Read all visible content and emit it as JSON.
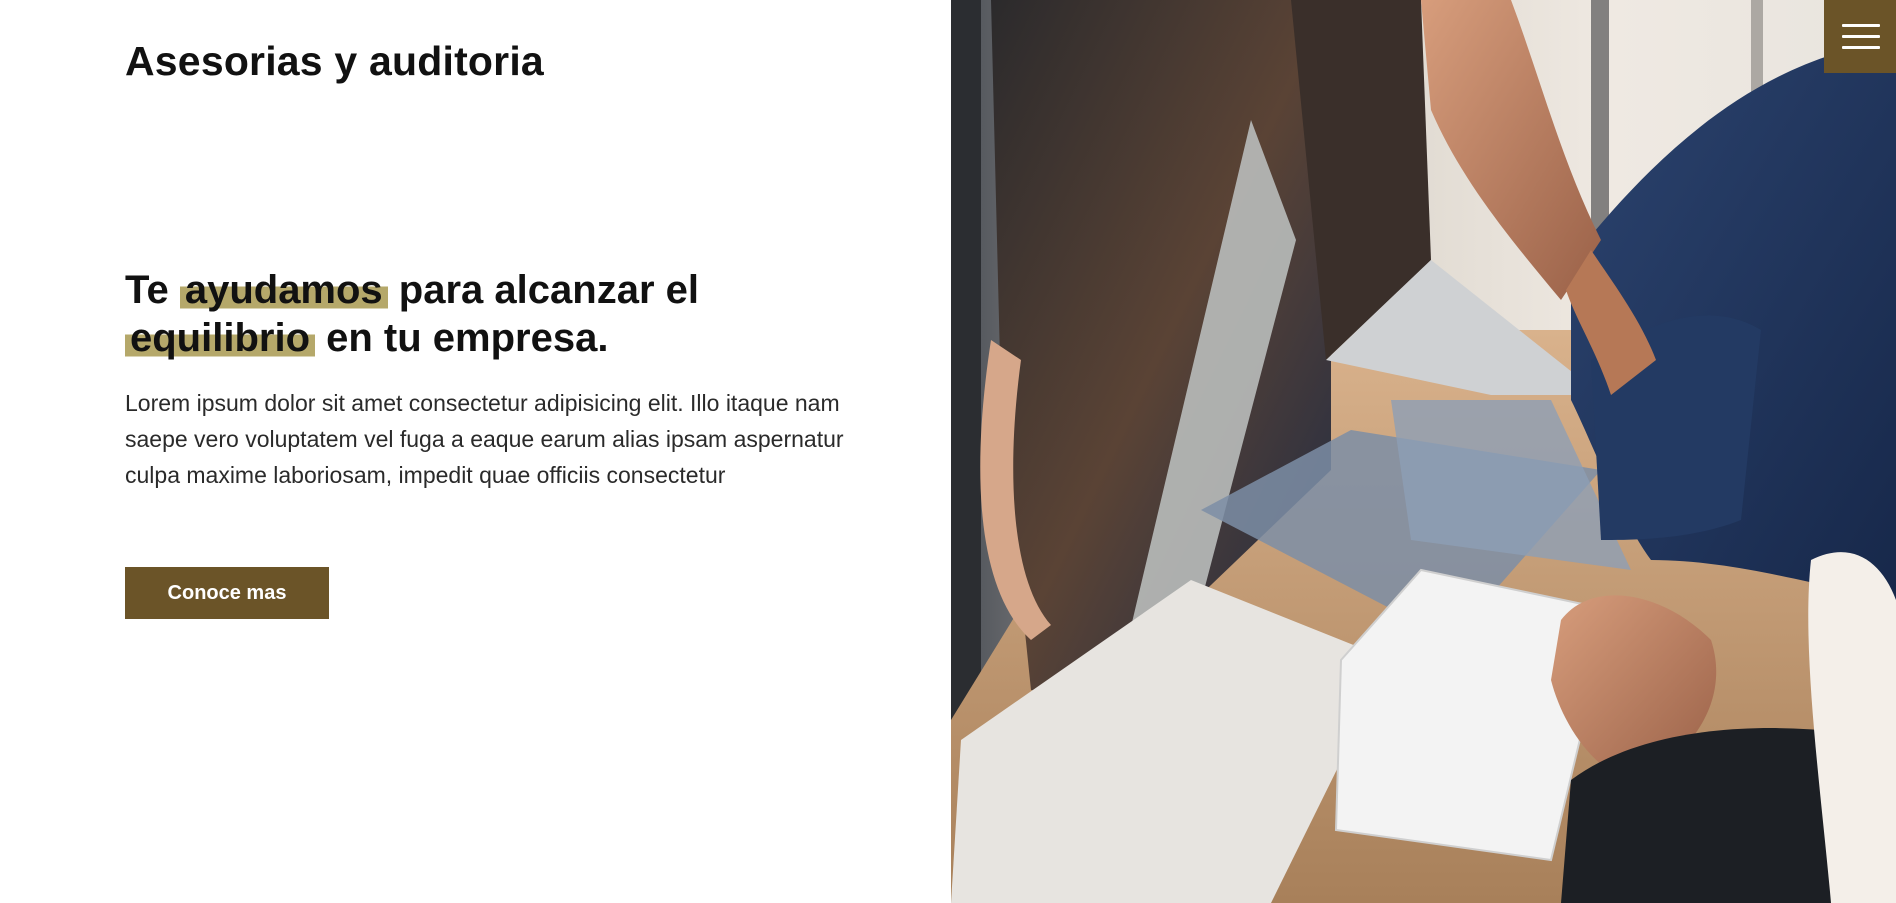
{
  "header": {
    "site_title": "Asesorias y auditoria",
    "menu_icon": "hamburger-menu-icon"
  },
  "hero": {
    "heading_part1": "Te ",
    "heading_highlight1": "ayudamos",
    "heading_part2": " para alcanzar el ",
    "heading_highlight2": "equilibrio",
    "heading_part3": " en tu empresa.",
    "text": "Lorem ipsum dolor sit amet consectetur adipisicing elit. Illo itaque nam saepe vero voluptatem vel fuga a eaque earum alias ipsam aspernatur culpa maxime laboriosam, impedit quae officiis consectetur",
    "cta_label": "Conoce mas"
  },
  "colors": {
    "accent": "#6b5428",
    "highlight": "#b5a86a",
    "text": "#111111",
    "background": "#ffffff"
  }
}
